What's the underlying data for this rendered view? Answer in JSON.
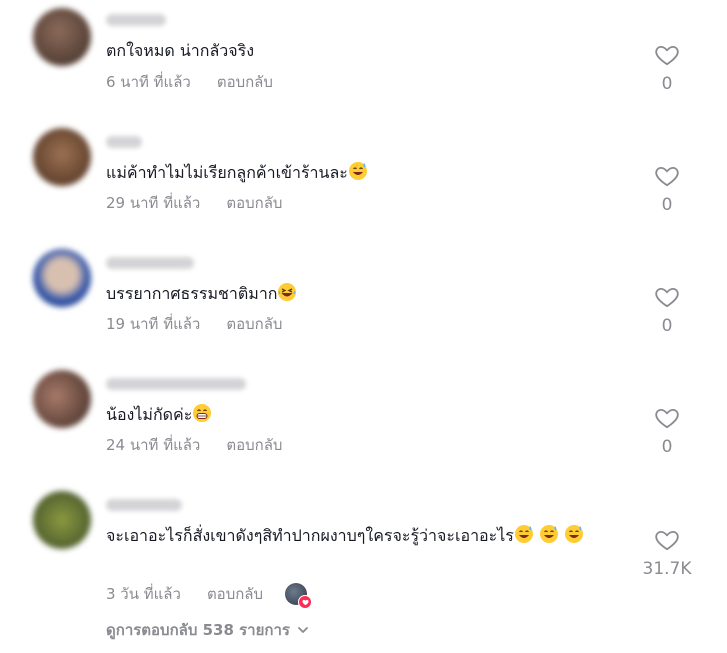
{
  "comments": [
    {
      "text": "ตกใจหมด น่ากลัวจริง",
      "time": "6 นาที ที่แล้ว",
      "reply_label": "ตอบกลับ",
      "likes": "0"
    },
    {
      "text": "แม่ค้าทำไมไม่เรียกลูกค้าเข้าร้านละ",
      "time": "29 นาที ที่แล้ว",
      "reply_label": "ตอบกลับ",
      "likes": "0"
    },
    {
      "text": "บรรยากาศธรรมชาติมาก",
      "time": "19 นาที ที่แล้ว",
      "reply_label": "ตอบกลับ",
      "likes": "0"
    },
    {
      "text": "น้องไม่กัดค่ะ",
      "time": "24 นาที ที่แล้ว",
      "reply_label": "ตอบกลับ",
      "likes": "0"
    },
    {
      "text": "จะเอาอะไรก็สั่งเขาดังๆสิทำปากผงาบๆใครจะรู้ว่าจะเอาอะไร",
      "time": "3 วัน ที่แล้ว",
      "reply_label": "ตอบกลับ",
      "likes": "31.7K"
    }
  ],
  "view_replies_label": "ดูการตอบกลับ 538 รายการ",
  "icons": {
    "like": "heart-outline-icon",
    "expand": "chevron-down-icon",
    "emoji_sweat_smile": "sweat-smile-emoji",
    "emoji_laugh": "laughing-emoji",
    "emoji_grin": "grinning-emoji",
    "creator_liked": "creator-liked-heart-icon"
  },
  "colors": {
    "text": "#161823",
    "muted": "#8a8b91",
    "like_red": "#fe2c55"
  }
}
